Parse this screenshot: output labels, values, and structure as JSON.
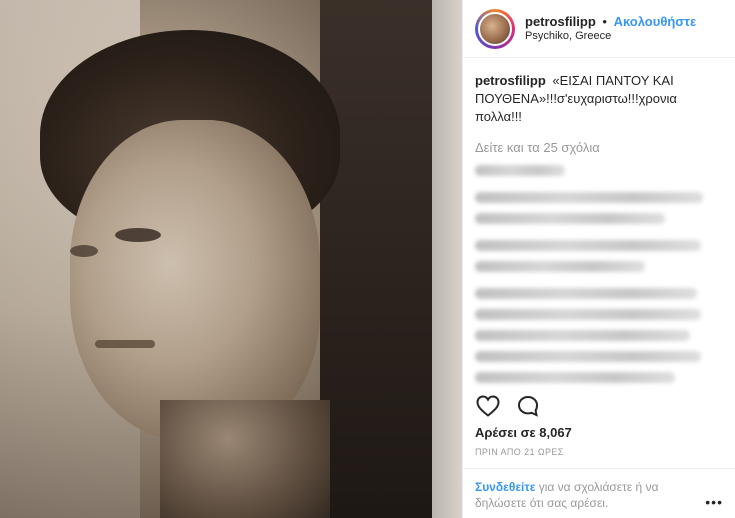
{
  "post": {
    "username": "petrosfilipp",
    "follow_dot": "•",
    "follow_label": "Ακολουθήστε",
    "location": "Psychiko, Greece",
    "caption_user": "petrosfilipp",
    "caption_text": "«ΕΙΣΑΙ ΠΑΝΤΟΥ ΚΑΙ ΠΟΥΘΕΝΑ»!!!σ'ευχαριστω!!!χρονια πολλα!!!",
    "view_all_comments": "Δείτε και τα 25 σχόλια",
    "likes": "Αρέσει σε 8,067",
    "timestamp": "ΠΡΙΝ ΑΠΟ 21 ΩΡΕΣ",
    "footer_link": "Συνδεθείτε",
    "footer_text": " για να σχολιάσετε ή να δηλώσετε ότι σας αρέσει.",
    "more_label": "•••"
  },
  "icons": {
    "like": "heart-icon",
    "comment": "comment-icon"
  }
}
